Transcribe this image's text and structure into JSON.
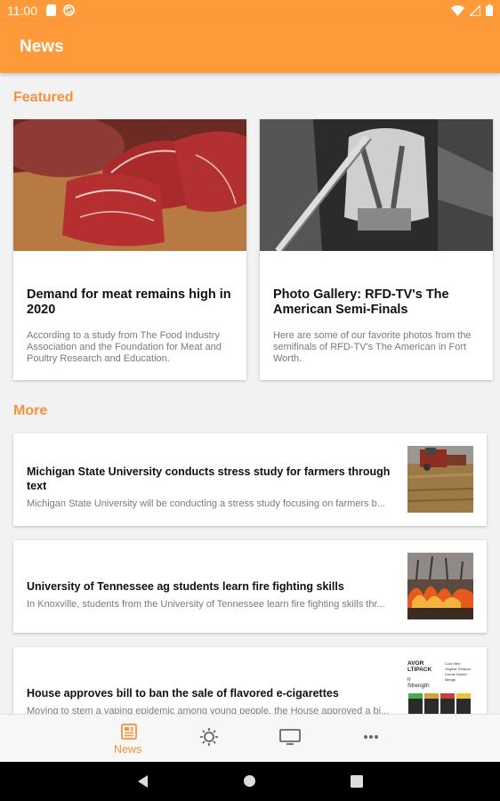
{
  "status": {
    "time": "11:00"
  },
  "app_bar": {
    "title": "News"
  },
  "featured": {
    "heading": "Featured",
    "items": [
      {
        "title": "Demand for meat remains high in 2020",
        "description": "According to a study from The Food Industry Association and the Foundation for Meat and Poultry Research and Education."
      },
      {
        "title": "Photo Gallery: RFD-TV's The American Semi-Finals",
        "description": "Here are some of our favorite photos from the semifinals of RFD-TV's The American in Fort Worth."
      }
    ]
  },
  "more": {
    "heading": "More",
    "items": [
      {
        "title": "Michigan State University conducts stress study for farmers through text",
        "description": "Michigan State University will be conducting a stress study focusing on farmers b..."
      },
      {
        "title": "University of Tennessee ag students learn fire fighting skills",
        "description": "In Knoxville, students from the University of Tennessee learn fire fighting skills thr..."
      },
      {
        "title": "House approves bill to ban the sale of flavored e-cigarettes",
        "description": "Moving to stem a vaping epidemic among young people, the House approved a bi..."
      }
    ]
  },
  "thumb3_text": {
    "line1": "AVOR",
    "line2": "LTIPACK",
    "line3": "n",
    "line4": "Strength",
    "legend": [
      "Cool Mint",
      "Virginia Tobacco",
      "Creme Brulee",
      "Mango"
    ]
  },
  "bottom_nav": {
    "news_label": "News"
  },
  "colors": {
    "accent": "#fe9a3a",
    "accent_text": "#f5923c"
  }
}
